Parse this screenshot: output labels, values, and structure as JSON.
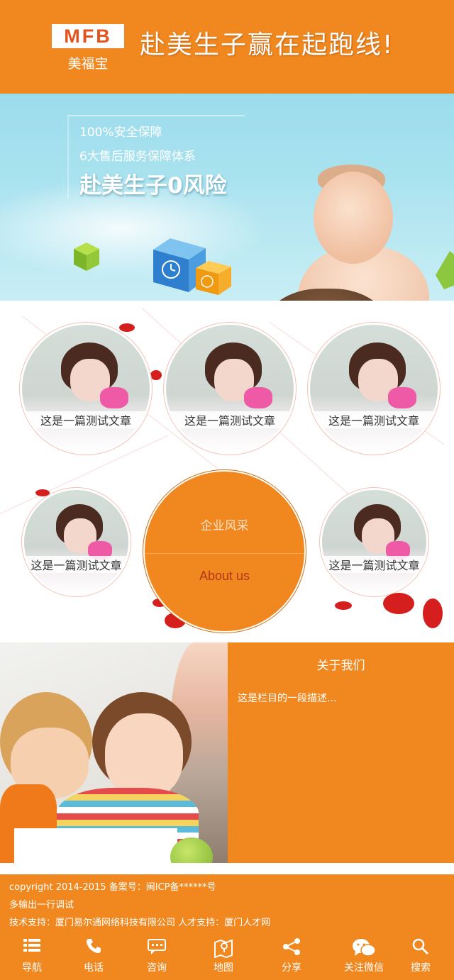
{
  "header": {
    "logo_text": "MFB",
    "logo_sub": "美福宝",
    "slogan": "赴美生子赢在起跑线!"
  },
  "banner": {
    "line1": "100%安全保障",
    "line2": "6大售后服务保障体系",
    "headline": "赴美生子0风险"
  },
  "articles": {
    "items": [
      {
        "caption": "这是一篇测试文章"
      },
      {
        "caption": "这是一篇测试文章"
      },
      {
        "caption": "这是一篇测试文章"
      },
      {
        "caption": "这是一篇测试文章"
      },
      {
        "caption": "这是一篇测试文章"
      }
    ],
    "center_title": "企业风采",
    "center_subtitle": "About us"
  },
  "about": {
    "title": "关于我们",
    "description": "这是栏目的一段描述..."
  },
  "footer": {
    "line1": "copyright 2014-2015 备案号：闽ICP备******号",
    "line2": "多输出一行调试",
    "line3": "技术支持：厦门易尔通网络科技有限公司 人才支持：厦门人才网"
  },
  "bottom_nav": {
    "items": [
      {
        "label": "导航",
        "icon": "list-icon"
      },
      {
        "label": "电话",
        "icon": "phone-icon"
      },
      {
        "label": "咨询",
        "icon": "chat-icon"
      },
      {
        "label": "地图",
        "icon": "map-icon"
      },
      {
        "label": "分享",
        "icon": "share-icon"
      },
      {
        "label": "关注微信",
        "icon": "wechat-icon"
      },
      {
        "label": "搜索",
        "icon": "search-icon"
      }
    ]
  },
  "colors": {
    "brand_orange": "#f0881f",
    "logo_red": "#e3541d",
    "about_en": "#b5371a"
  }
}
